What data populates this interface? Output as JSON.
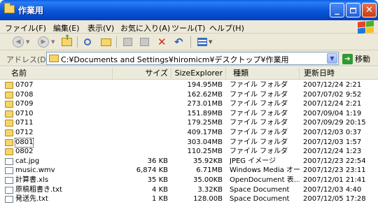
{
  "window": {
    "title": "作業用"
  },
  "menu": [
    "ファイル(F)",
    "編集(E)",
    "表示(V)",
    "お気に入り(A)",
    "ツール(T)",
    "ヘルプ(H)"
  ],
  "address": {
    "label": "アドレス(D)",
    "path": "C:¥Documents and Settings¥hiromicm¥デスクトップ¥作業用",
    "go_label": "移動"
  },
  "columns": {
    "name": "名前",
    "size": "サイズ",
    "sizeexplorer": "SizeExplorer",
    "type": "種類",
    "date": "更新日時"
  },
  "rows": [
    {
      "name": "0707",
      "size": "",
      "se": "194.95MB",
      "type": "ファイル フォルダ",
      "date": "2007/12/24 2:21",
      "kind": "folder"
    },
    {
      "name": "0708",
      "size": "",
      "se": "162.62MB",
      "type": "ファイル フォルダ",
      "date": "2007/07/02 9:52",
      "kind": "folder"
    },
    {
      "name": "0709",
      "size": "",
      "se": "273.01MB",
      "type": "ファイル フォルダ",
      "date": "2007/12/24 2:21",
      "kind": "folder"
    },
    {
      "name": "0710",
      "size": "",
      "se": "151.89MB",
      "type": "ファイル フォルダ",
      "date": "2007/09/04 1:19",
      "kind": "folder"
    },
    {
      "name": "0711",
      "size": "",
      "se": "179.25MB",
      "type": "ファイル フォルダ",
      "date": "2007/09/29 20:15",
      "kind": "folder"
    },
    {
      "name": "0712",
      "size": "",
      "se": "409.17MB",
      "type": "ファイル フォルダ",
      "date": "2007/12/03 0:37",
      "kind": "folder"
    },
    {
      "name": "0801",
      "size": "",
      "se": "303.04MB",
      "type": "ファイル フォルダ",
      "date": "2007/12/03 1:57",
      "kind": "folder",
      "selected": true
    },
    {
      "name": "0802",
      "size": "",
      "se": "110.25MB",
      "type": "ファイル フォルダ",
      "date": "2007/12/24 1:23",
      "kind": "folder"
    },
    {
      "name": "cat.jpg",
      "size": "36 KB",
      "se": "35.92KB",
      "type": "JPEG イメージ",
      "date": "2007/12/23 22:54",
      "kind": "file"
    },
    {
      "name": "music.wmv",
      "size": "6,874 KB",
      "se": "6.71MB",
      "type": "Windows Media オー…",
      "date": "2007/12/23 23:11",
      "kind": "file"
    },
    {
      "name": "計算書.xls",
      "size": "35 KB",
      "se": "35.00KB",
      "type": "OpenDocument 表…",
      "date": "2007/12/01 21:41",
      "kind": "file"
    },
    {
      "name": "原稿粗書き.txt",
      "size": "4 KB",
      "se": "3.32KB",
      "type": "Space Document",
      "date": "2007/12/03 4:40",
      "kind": "file"
    },
    {
      "name": "発送先.txt",
      "size": "1 KB",
      "se": "128.00B",
      "type": "Space Document",
      "date": "2007/12/05 17:28",
      "kind": "file"
    }
  ]
}
